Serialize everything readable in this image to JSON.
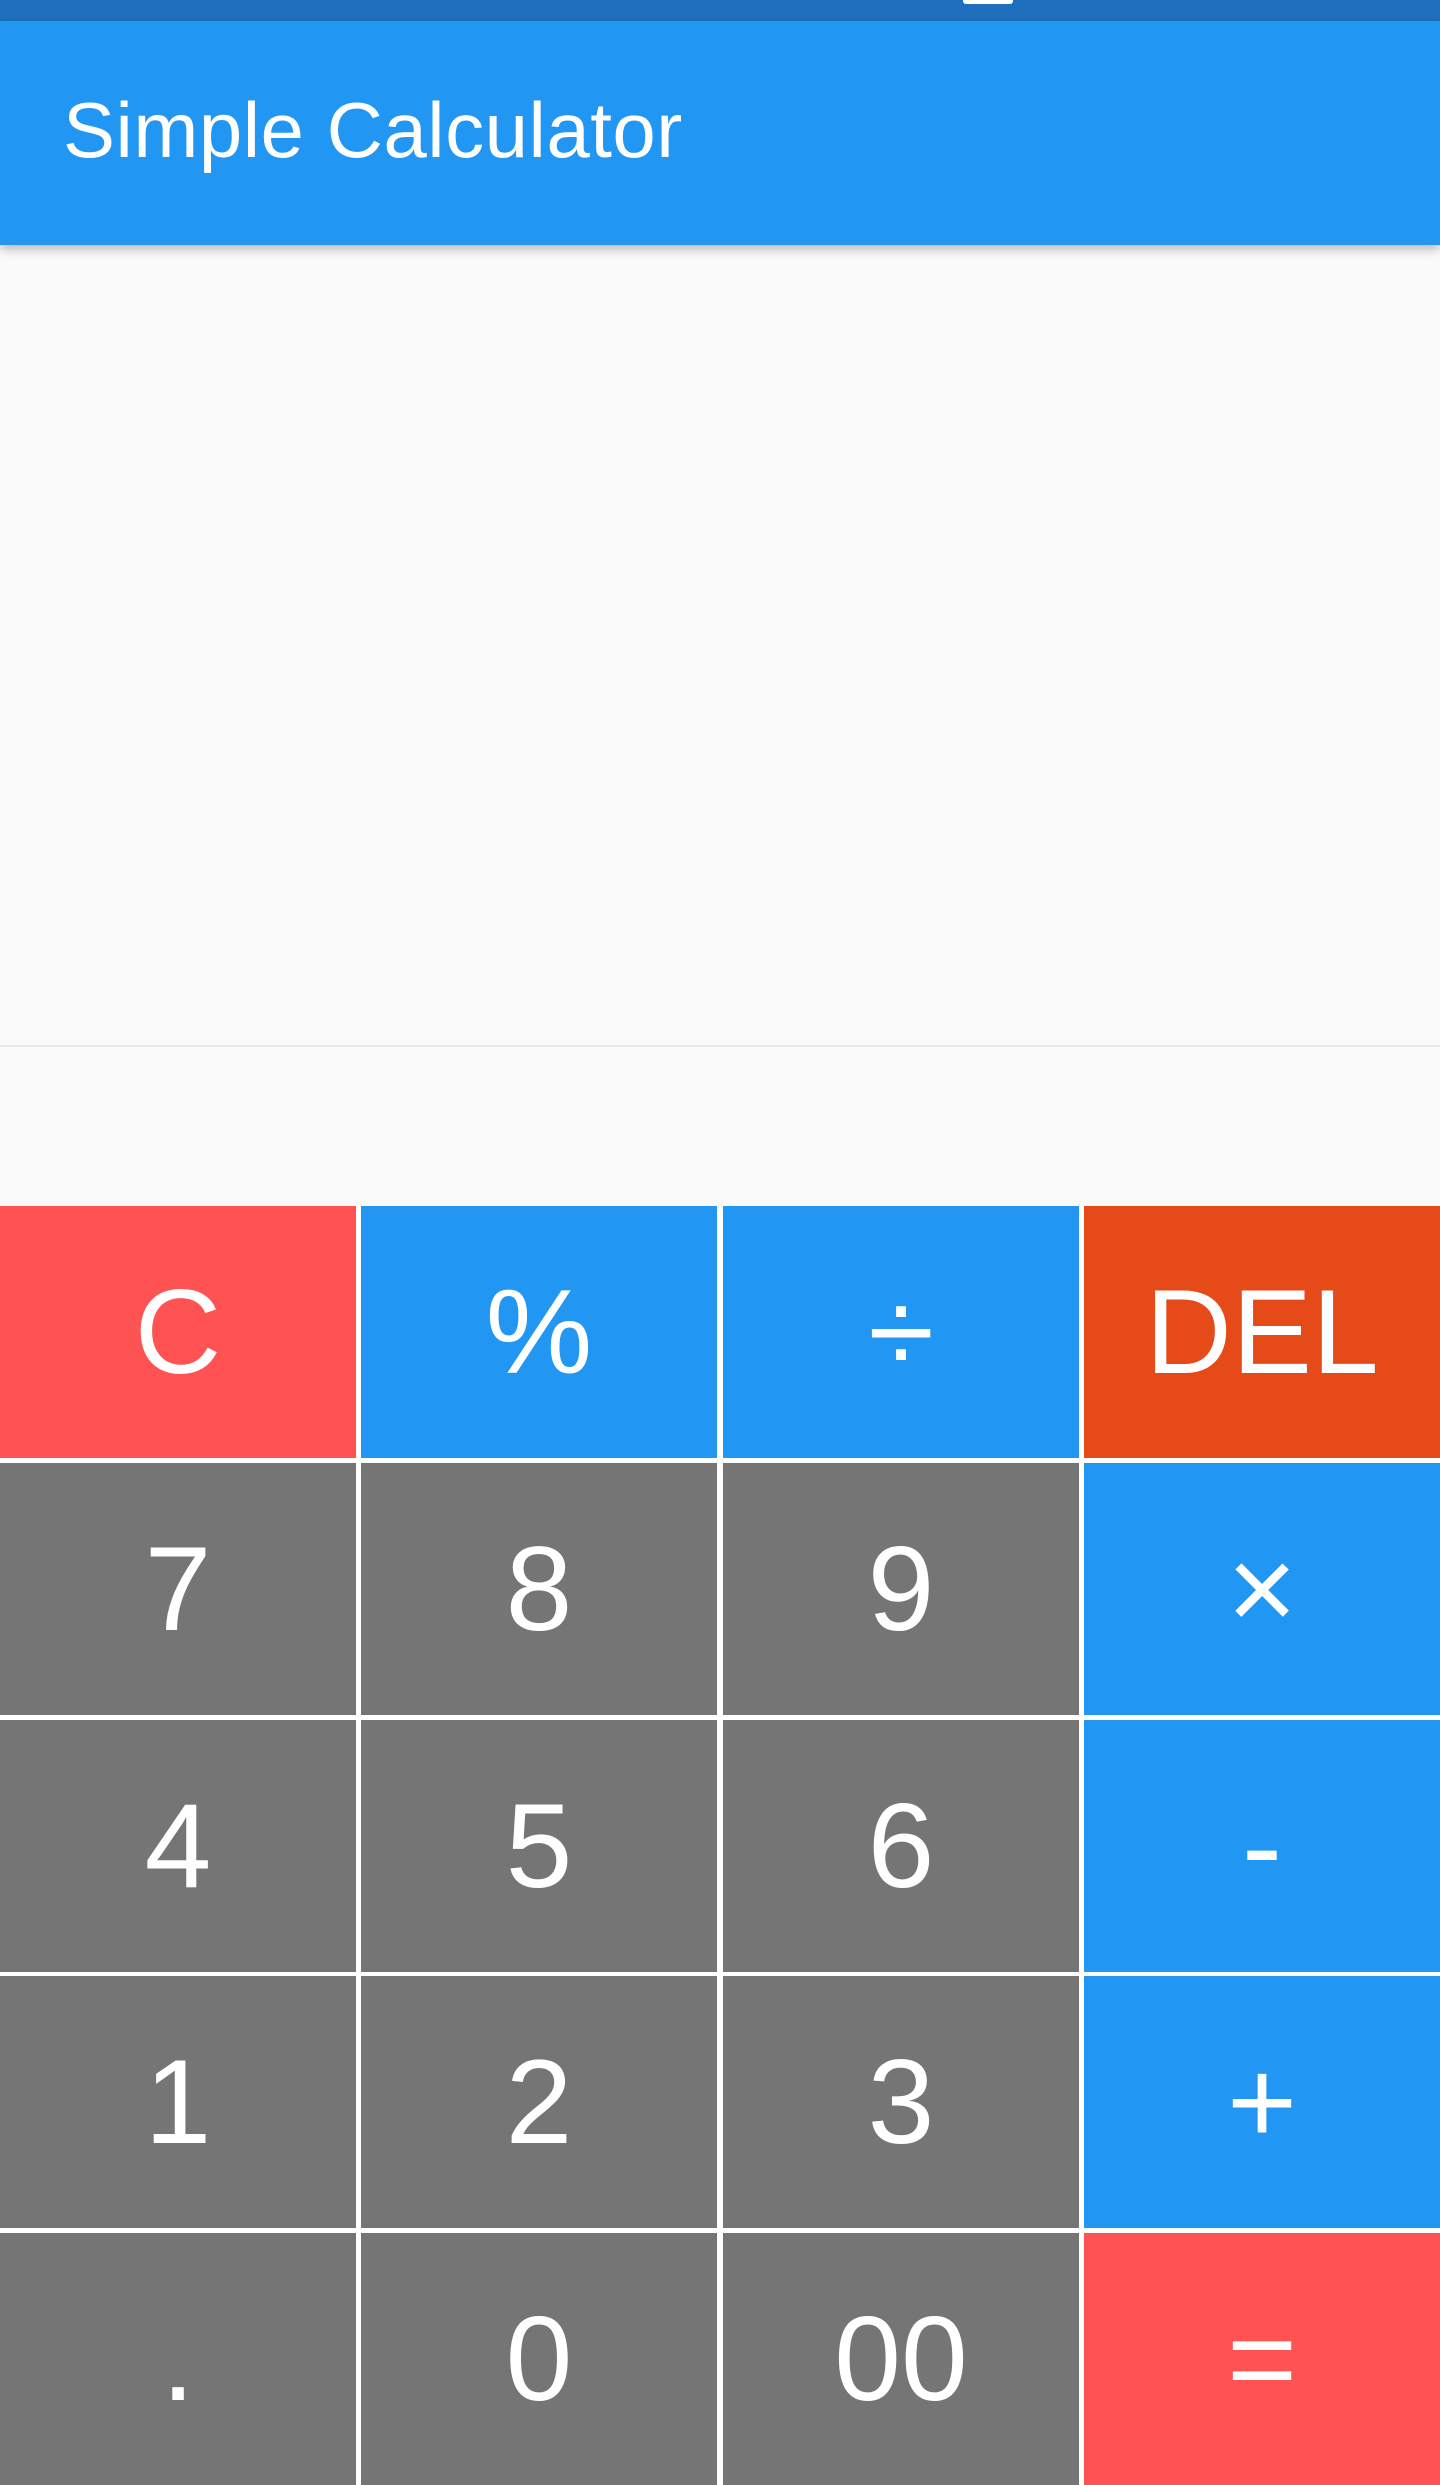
{
  "app": {
    "title": "Simple Calculator"
  },
  "colors": {
    "status_bar": "#1e70be",
    "app_bar": "#2196f3",
    "background": "#fafafa",
    "digit_key": "#757575",
    "operator_key": "#2196f3",
    "clear_key": "#ff5252",
    "delete_key": "#e64a19",
    "equals_key": "#ff5252"
  },
  "display": {
    "expression": "",
    "result": ""
  },
  "keypad": {
    "rows": [
      [
        {
          "label": "C",
          "name": "clear-button",
          "color": "red"
        },
        {
          "label": "%",
          "name": "percent-button",
          "color": "blue"
        },
        {
          "label": "÷",
          "name": "divide-button",
          "color": "blue"
        },
        {
          "label": "DEL",
          "name": "delete-button",
          "color": "orange"
        }
      ],
      [
        {
          "label": "7",
          "name": "digit-7-button",
          "color": "gray"
        },
        {
          "label": "8",
          "name": "digit-8-button",
          "color": "gray"
        },
        {
          "label": "9",
          "name": "digit-9-button",
          "color": "gray"
        },
        {
          "label": "×",
          "name": "multiply-button",
          "color": "blue"
        }
      ],
      [
        {
          "label": "4",
          "name": "digit-4-button",
          "color": "gray"
        },
        {
          "label": "5",
          "name": "digit-5-button",
          "color": "gray"
        },
        {
          "label": "6",
          "name": "digit-6-button",
          "color": "gray"
        },
        {
          "label": "-",
          "name": "subtract-button",
          "color": "blue"
        }
      ],
      [
        {
          "label": "1",
          "name": "digit-1-button",
          "color": "gray"
        },
        {
          "label": "2",
          "name": "digit-2-button",
          "color": "gray"
        },
        {
          "label": "3",
          "name": "digit-3-button",
          "color": "gray"
        },
        {
          "label": "+",
          "name": "add-button",
          "color": "blue"
        }
      ],
      [
        {
          "label": ".",
          "name": "decimal-point-button",
          "color": "gray"
        },
        {
          "label": "0",
          "name": "digit-0-button",
          "color": "gray"
        },
        {
          "label": "00",
          "name": "double-zero-button",
          "color": "gray"
        },
        {
          "label": "=",
          "name": "equals-button",
          "color": "red"
        }
      ]
    ]
  }
}
